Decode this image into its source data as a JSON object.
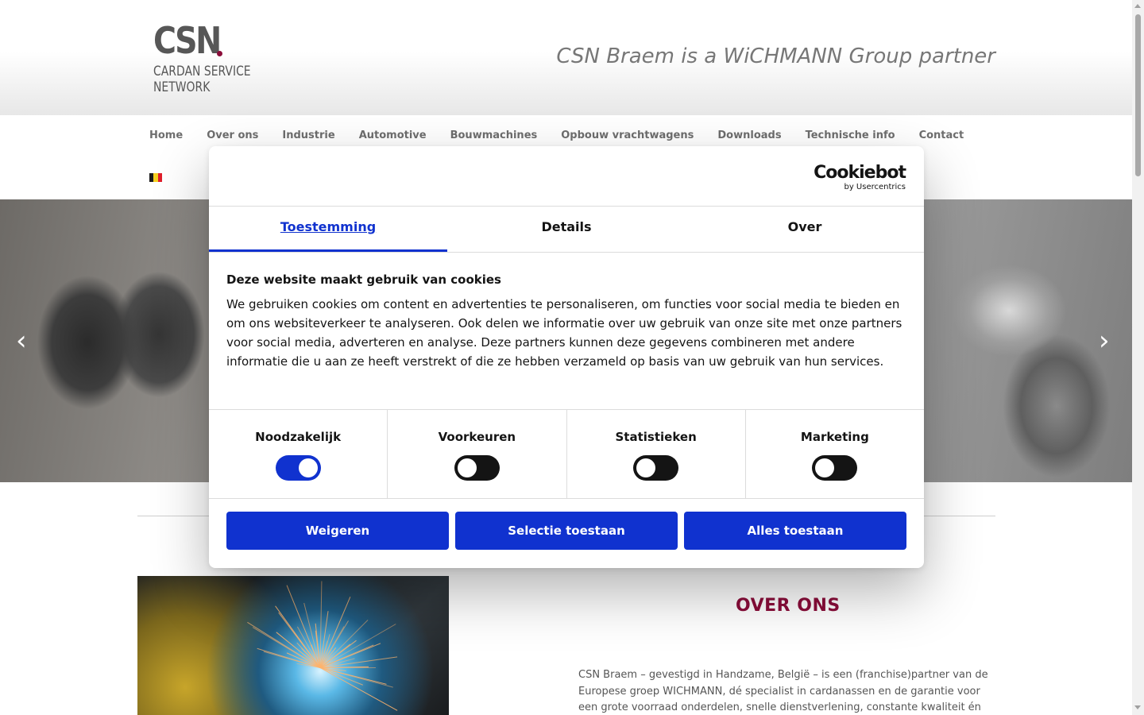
{
  "header": {
    "logo_text": "CSN",
    "logo_sub1": "CARDAN SERVICE",
    "logo_sub2": "NETWORK",
    "tagline": "CSN Braem is a WiCHMANN Group partner"
  },
  "nav": {
    "items": [
      "Home",
      "Over ons",
      "Industrie",
      "Automotive",
      "Bouwmachines",
      "Opbouw vrachtwagens",
      "Downloads",
      "Technische info",
      "Contact"
    ]
  },
  "hero": {
    "prev_icon": "‹",
    "next_icon": "›"
  },
  "content": {
    "over_title": "OVER ONS",
    "over_text": "CSN Braem – gevestigd in Handzame, België – is een (franchise)partner van de Europese groep WICHMANN, dé specialist in cardanassen en de garantie voor een grote voorraad onderdelen, snelle dienstverlening, constante kwaliteit én"
  },
  "cookie": {
    "brand": "Cookiebot",
    "brand_sub": "by Usercentrics",
    "tabs": [
      "Toestemming",
      "Details",
      "Over"
    ],
    "title": "Deze website maakt gebruik van cookies",
    "body": "We gebruiken cookies om content en advertenties te personaliseren, om functies voor social media te bieden en om ons websiteverkeer te analyseren. Ook delen we informatie over uw gebruik van onze site met onze partners voor social media, adverteren en analyse. Deze partners kunnen deze gegevens combineren met andere informatie die u aan ze heeft verstrekt of die ze hebben verzameld op basis van uw gebruik van hun services.",
    "categories": [
      {
        "label": "Noodzakelijk",
        "on": true
      },
      {
        "label": "Voorkeuren",
        "on": false
      },
      {
        "label": "Statistieken",
        "on": false
      },
      {
        "label": "Marketing",
        "on": false
      }
    ],
    "buttons": {
      "deny": "Weigeren",
      "selection": "Selectie toestaan",
      "allow_all": "Alles toestaan"
    }
  },
  "colors": {
    "accent_blue": "#1032cf",
    "brand_red": "#8b0d3a"
  }
}
